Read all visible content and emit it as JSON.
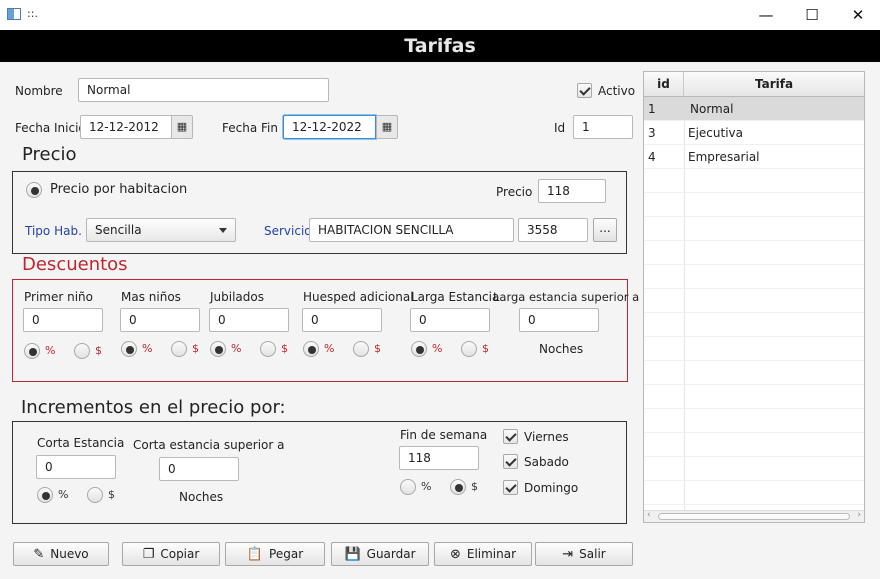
{
  "window": {
    "title": "::.",
    "minimize": "—",
    "maximize": "☐",
    "close": "✕"
  },
  "header": {
    "title": "Tarifas"
  },
  "form": {
    "nombre_label": "Nombre",
    "nombre_value": "Normal",
    "activo_label": "Activo",
    "activo_checked": true,
    "fecha_inicio_label": "Fecha Inicio",
    "fecha_inicio_value": "12-12-2012",
    "fecha_fin_label": "Fecha Fin",
    "fecha_fin_value": "12-12-2022",
    "id_label": "Id",
    "id_value": "1"
  },
  "precio": {
    "title": "Precio",
    "precio_por_habitacion_label": "Precio por habitacion",
    "precio_label": "Precio",
    "precio_value": "118",
    "tipo_hab_label": "Tipo Hab.",
    "tipo_hab_value": "Sencilla",
    "servicio_label": "Servicio",
    "servicio_value": "HABITACION SENCILLA",
    "servicio_code": "3558",
    "browse_label": "..."
  },
  "descuentos": {
    "title": "Descuentos",
    "percent": "%",
    "dollar": "$",
    "noches": "Noches",
    "fields": [
      {
        "label": "Primer niño",
        "value": "0"
      },
      {
        "label": "Mas niños",
        "value": "0"
      },
      {
        "label": "Jubilados",
        "value": "0"
      },
      {
        "label": "Huesped adicional",
        "value": "0"
      },
      {
        "label": "Larga Estancia",
        "value": "0"
      },
      {
        "label": "Larga estancia superior a",
        "value": "0"
      }
    ]
  },
  "incrementos": {
    "title": "Incrementos en el precio por:",
    "corta_label": "Corta Estancia",
    "corta_value": "0",
    "corta_sup_label": "Corta estancia superior a",
    "corta_sup_value": "0",
    "noches": "Noches",
    "fin_semana_label": "Fin de semana",
    "fin_semana_value": "118",
    "percent": "%",
    "dollar": "$",
    "viernes": "Viernes",
    "sabado": "Sabado",
    "domingo": "Domingo"
  },
  "buttons": {
    "nuevo": "Nuevo",
    "copiar": "Copiar",
    "pegar": "Pegar",
    "guardar": "Guardar",
    "eliminar": "Eliminar",
    "salir": "Salir"
  },
  "table": {
    "col_id": "id",
    "col_tarifa": "Tarifa",
    "rows": [
      {
        "id": "1",
        "tarifa": "Normal"
      },
      {
        "id": "3",
        "tarifa": "Ejecutiva"
      },
      {
        "id": "4",
        "tarifa": "Empresarial"
      }
    ]
  }
}
